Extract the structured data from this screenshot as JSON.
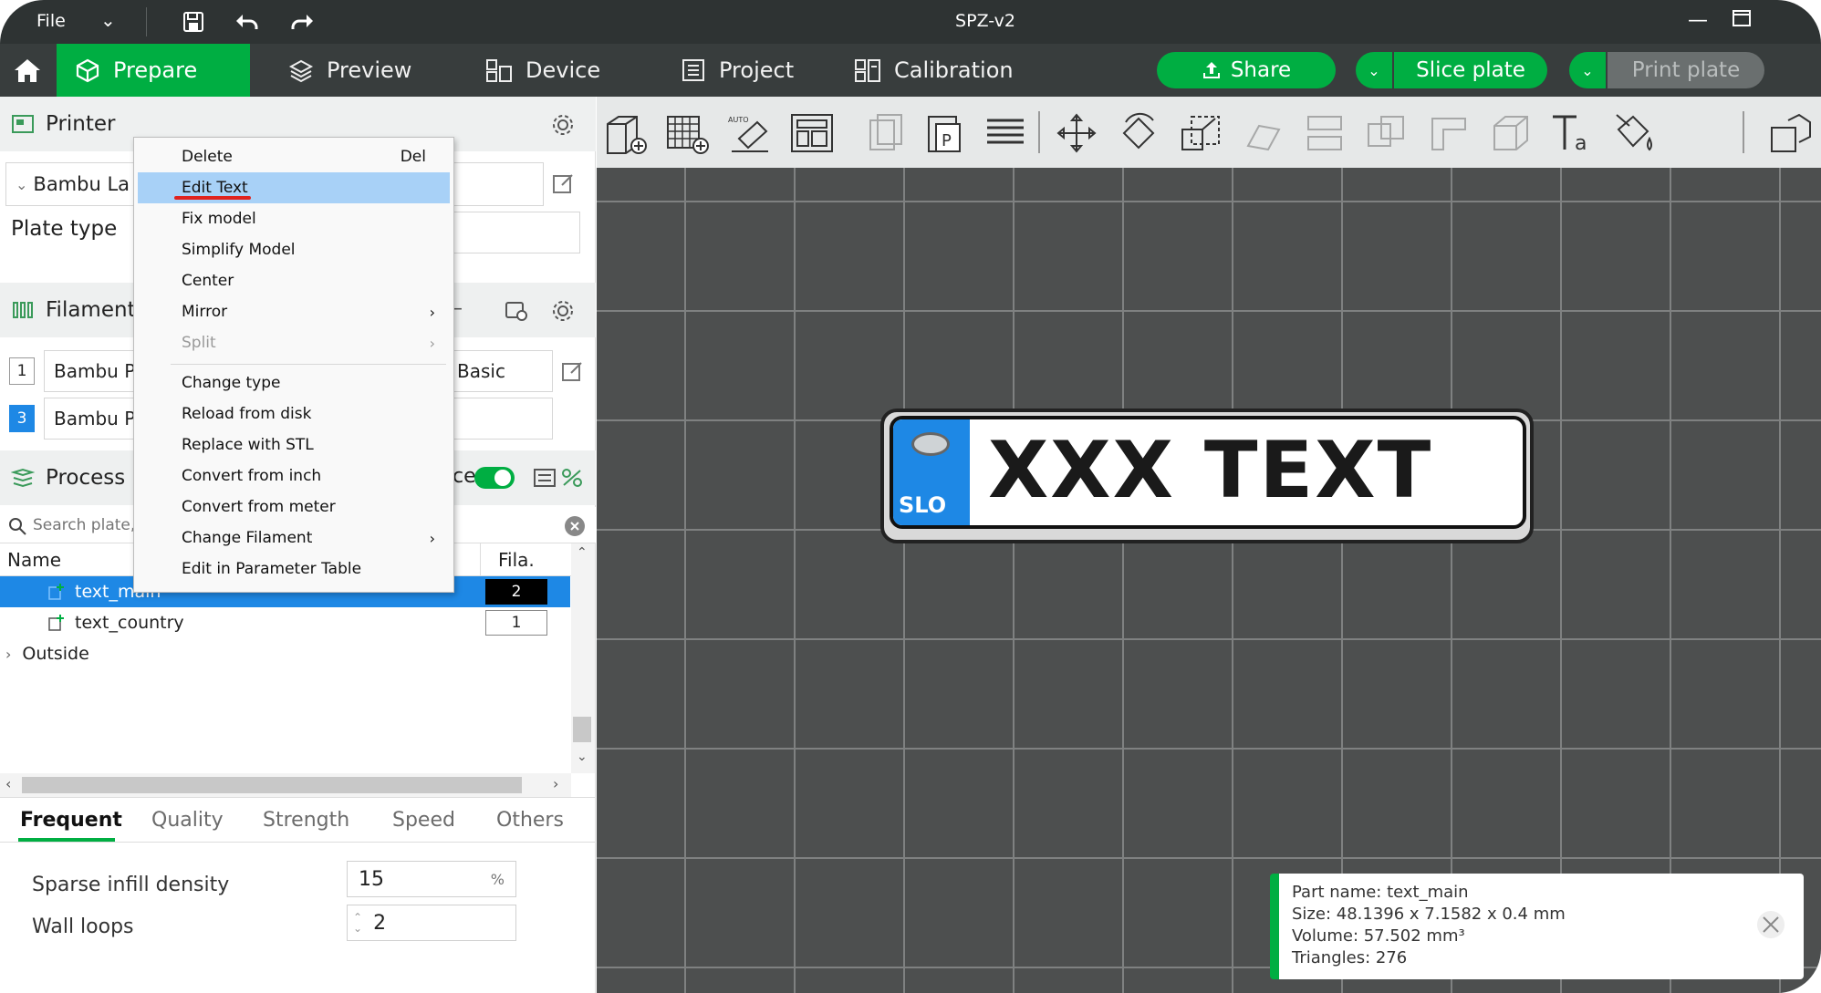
{
  "titlebar": {
    "file_label": "File",
    "title": "SPZ-v2"
  },
  "nav": {
    "tabs": [
      {
        "label": "Prepare",
        "icon": "cube-icon"
      },
      {
        "label": "Preview",
        "icon": "layers-icon"
      },
      {
        "label": "Device",
        "icon": "device-icon"
      },
      {
        "label": "Project",
        "icon": "project-icon"
      },
      {
        "label": "Calibration",
        "icon": "calibration-icon"
      }
    ],
    "share_label": "Share",
    "slice_label": "Slice plate",
    "print_label": "Print plate",
    "accent_color": "#00ae42"
  },
  "left": {
    "printer_label": "Printer",
    "printer_value": "Bambu La",
    "plate_type_label": "Plate type",
    "filament_label": "Filament",
    "filaments": [
      {
        "num": "1",
        "name": "Bambu Pl"
      },
      {
        "num": "3",
        "name": "Bambu Pl"
      }
    ],
    "filament_right_value": "Basic",
    "process_label": "Process",
    "process_toggle_fragment": "ce",
    "search_placeholder": "Search plate,",
    "col_name": "Name",
    "col_fila": "Fila.",
    "objects": [
      {
        "name": "text_main",
        "fila": "2"
      },
      {
        "name": "text_country",
        "fila": "1"
      }
    ],
    "group_outside": "Outside",
    "tabs": [
      "Frequent",
      "Quality",
      "Strength",
      "Speed",
      "Others"
    ],
    "params": [
      {
        "label": "Sparse infill density",
        "value": "15",
        "unit": "%"
      },
      {
        "label": "Wall loops",
        "value": "2"
      }
    ]
  },
  "context_menu": {
    "items": [
      {
        "label": "Delete",
        "shortcut": "Del"
      },
      {
        "label": "Edit Text"
      },
      {
        "label": "Fix model"
      },
      {
        "label": "Simplify Model"
      },
      {
        "label": "Center"
      },
      {
        "label": "Mirror"
      },
      {
        "label": "Split"
      },
      {
        "label": "Change type"
      },
      {
        "label": "Reload from disk"
      },
      {
        "label": "Replace with STL"
      },
      {
        "label": "Convert from inch"
      },
      {
        "label": "Convert from meter"
      },
      {
        "label": "Change Filament"
      },
      {
        "label": "Edit in Parameter Table"
      }
    ]
  },
  "plate_model": {
    "country": "SLO",
    "text": "XXX TEXT"
  },
  "info": {
    "part_name": "Part name: text_main",
    "size": "Size: 48.1396 x 7.1582 x 0.4 mm",
    "volume": "Volume: 57.502 mm³",
    "triangles": "Triangles: 276"
  }
}
